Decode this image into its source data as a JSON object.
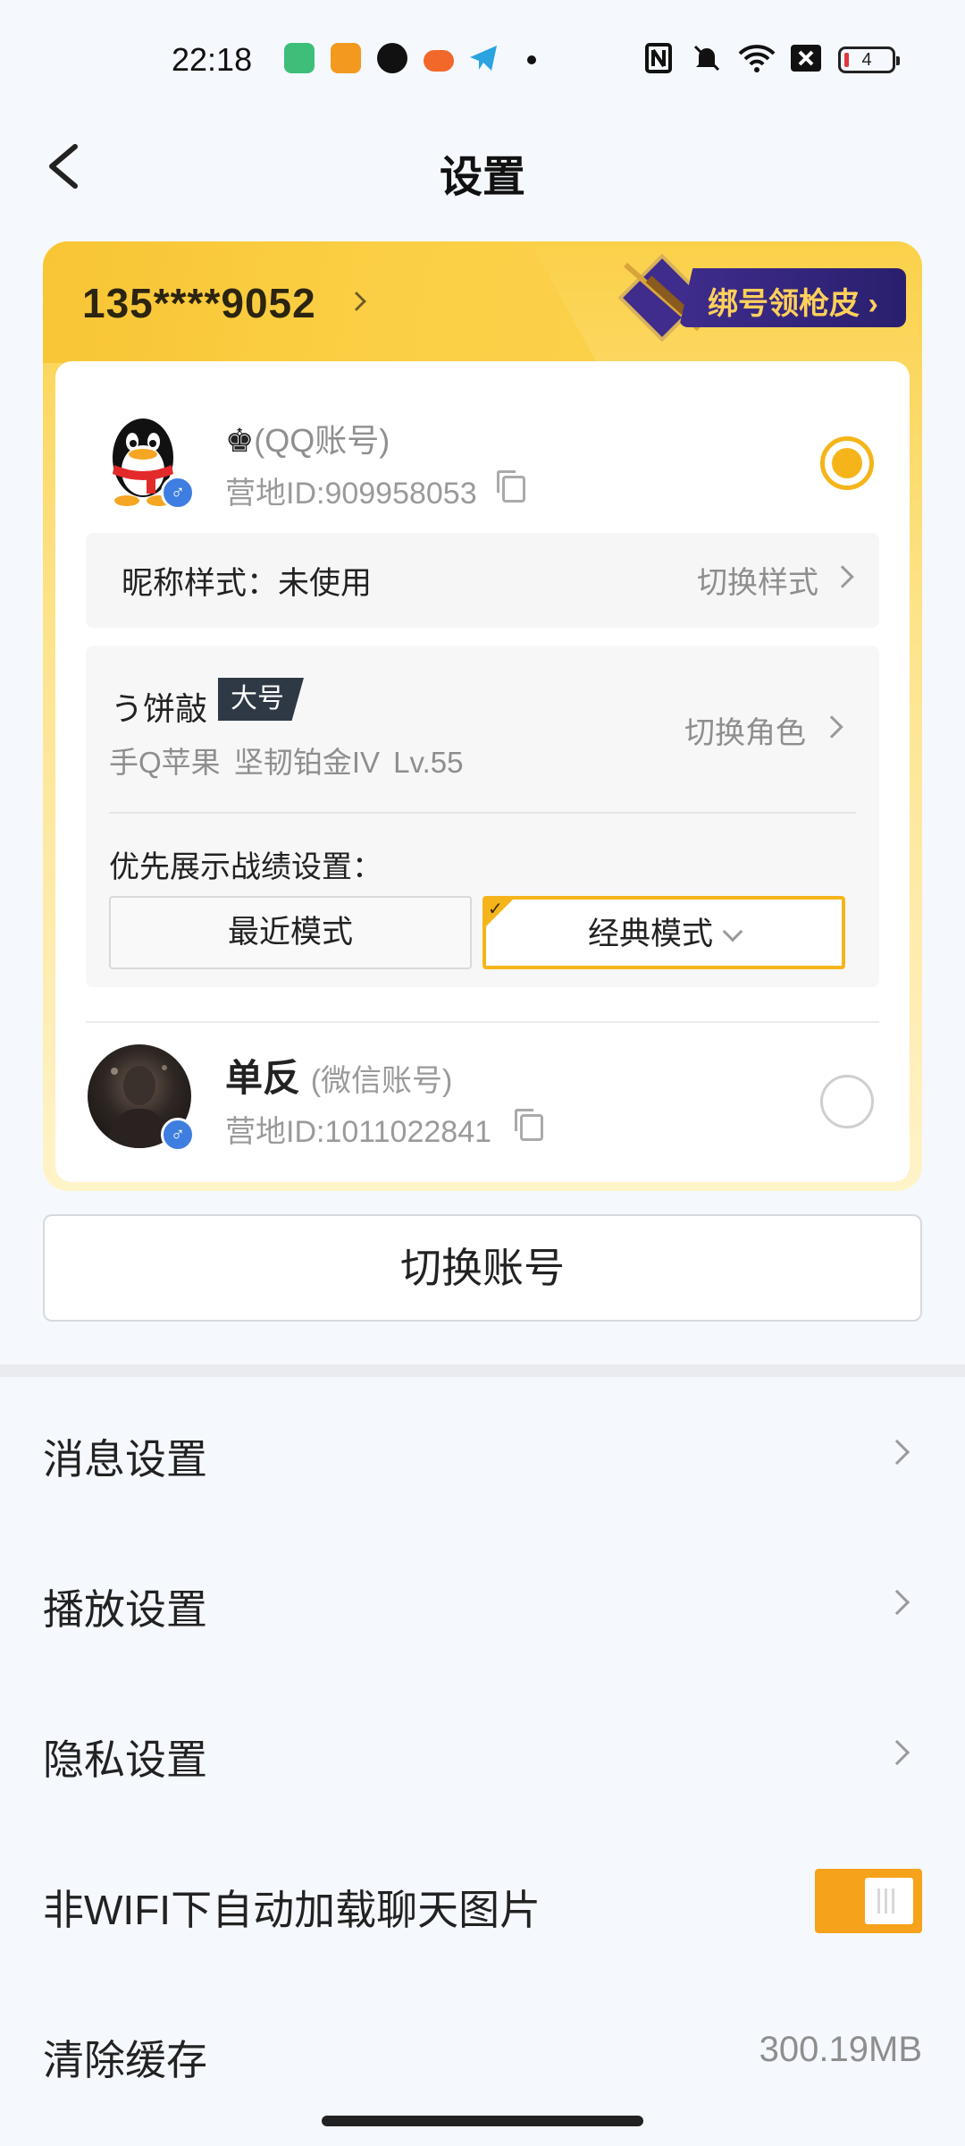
{
  "status_bar": {
    "time": "22:18",
    "battery": "4",
    "left_icons": [
      "battery-saver-icon",
      "app-icon-orange",
      "shield-app-icon",
      "game-app-icon",
      "telegram-icon",
      "dot-icon"
    ],
    "right_icons": [
      "nfc-icon",
      "mute-icon",
      "wifi-icon",
      "sim-off-icon",
      "battery-icon"
    ]
  },
  "header": {
    "title": "设置",
    "back_icon": "back-arrow-icon"
  },
  "account_card": {
    "phone": "135****9052",
    "bind_badge": "绑号领枪皮",
    "qq_account": {
      "crown": "♚",
      "name": "(QQ账号)",
      "id": "营地ID:909958053",
      "selected": true
    },
    "nickname_style": {
      "label": "昵称样式：未使用",
      "action": "切换样式"
    },
    "role": {
      "name": "う饼敲",
      "tag": "大号",
      "info": "手Q苹果  坚韧铂金IV  Lv.55",
      "action": "切换角色"
    },
    "record_pref": {
      "label": "优先展示战绩设置：",
      "options": [
        "最近模式",
        "经典模式"
      ],
      "selected": "经典模式"
    },
    "wechat_account": {
      "name": "单反",
      "type": "(微信账号)",
      "id": "营地ID:1011022841",
      "selected": false
    }
  },
  "switch_account_label": "切换账号",
  "settings": [
    {
      "label": "消息设置"
    },
    {
      "label": "播放设置"
    },
    {
      "label": "隐私设置"
    },
    {
      "label": "非WIFI下自动加载聊天图片",
      "toggle": true
    },
    {
      "label": "清除缓存",
      "value": "300.19MB"
    }
  ],
  "colors": {
    "accent": "#f5b51a",
    "toggle_on": "#f6a21b",
    "card_gold": "#fbd14a",
    "gender_blue": "#3e7ee0"
  }
}
